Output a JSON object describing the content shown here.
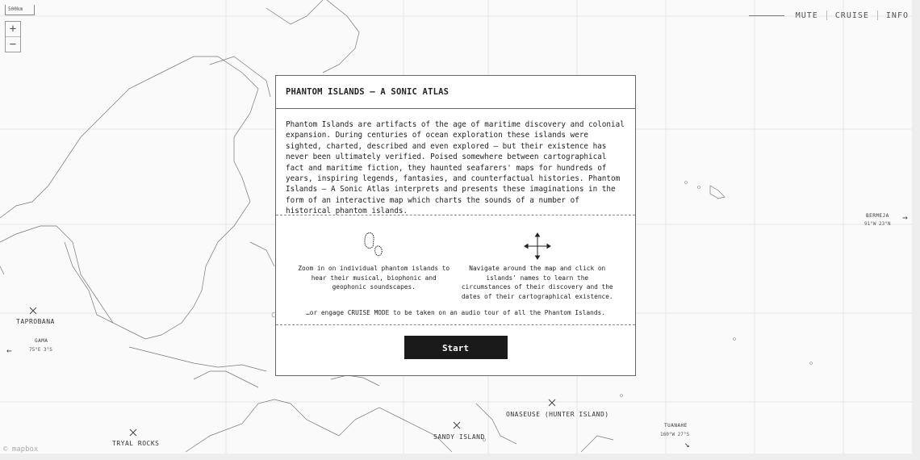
{
  "map": {
    "scale_label": "500km",
    "zoom_in": "+",
    "zoom_out": "−",
    "attribution": "© mapbox"
  },
  "nav": {
    "mute": "MUTE",
    "cruise": "CRUISE",
    "info": "INFO"
  },
  "islands": [
    {
      "name": "TAPROBANA"
    },
    {
      "name": "GAMA",
      "coords": "75°E 3°S"
    },
    {
      "name": "TRYAL ROCKS"
    },
    {
      "name": "SANDY ISLAND"
    },
    {
      "name": "ONASEUSE (HUNTER ISLAND)"
    },
    {
      "name": "TUANAHE",
      "coords": "160°W 27°S"
    },
    {
      "name": "BERMEJA",
      "coords": "91°W 23°N"
    }
  ],
  "modal": {
    "title": "PHANTOM ISLANDS — A SONIC ATLAS",
    "intro": "Phantom Islands are artifacts of the age of maritime discovery and colonial expansion. During centuries of ocean exploration these islands were sighted, charted, described and even explored — but their existence has never been ultimately verified. Poised somewhere between cartographical fact and maritime fiction, they haunted seafarers' maps for hundreds of years, inspiring legends, fantasies, and counterfactual histories. Phantom Islands — A Sonic Atlas interprets and presents these imaginations in the form of an interactive map which charts the sounds of a number of historical phantom islands.",
    "zoom_tip": "Zoom in on individual phantom islands to hear their musical, biophonic and geophonic soundscapes.",
    "navigate_tip": "Navigate around the map and click on islands' names to learn the circumstances of their discovery and the dates of their cartographical existence.",
    "cruise_tip": "…or engage CRUISE MODE to be taken on an audio tour of all the Phantom Islands.",
    "start_label": "Start"
  }
}
